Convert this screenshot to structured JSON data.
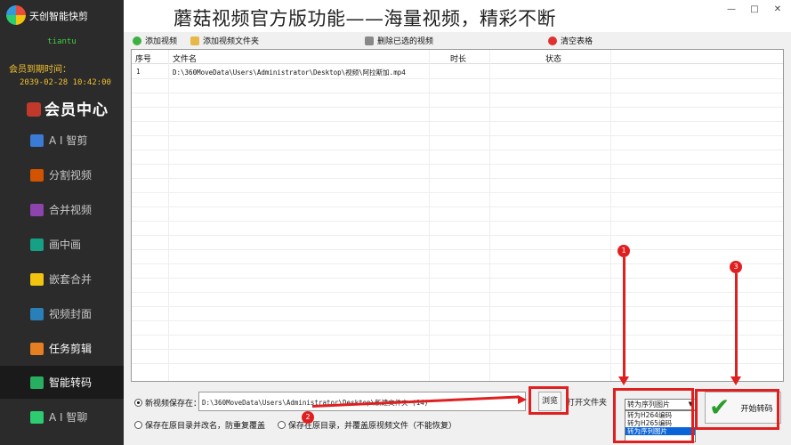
{
  "app": {
    "title": "天创智能快剪",
    "username": "tiantu",
    "expiry_label": "会员到期时间：",
    "expiry_time": "2039-02-28 10:42:00",
    "member_center": "会员中心"
  },
  "sidebar": {
    "items": [
      {
        "label": "A I 智剪",
        "icon": "ai-cut-icon",
        "color": "#3a7bd5"
      },
      {
        "label": "分割视频",
        "icon": "split-video-icon",
        "color": "#d35400"
      },
      {
        "label": "合并视频",
        "icon": "merge-video-icon",
        "color": "#8e44ad"
      },
      {
        "label": "画中画",
        "icon": "picture-in-picture-icon",
        "color": "#16a085"
      },
      {
        "label": "嵌套合并",
        "icon": "nested-merge-icon",
        "color": "#f1c40f"
      },
      {
        "label": "视频封面",
        "icon": "video-cover-icon",
        "color": "#2980b9"
      },
      {
        "label": "任务剪辑",
        "icon": "task-edit-icon",
        "color": "#e67e22"
      },
      {
        "label": "智能转码",
        "icon": "smart-transcode-icon",
        "color": "#27ae60",
        "active": true
      },
      {
        "label": "A I 智聊",
        "icon": "ai-chat-icon",
        "color": "#2ecc71"
      }
    ]
  },
  "banner": {
    "text": "蘑菇视频官方版功能——海量视频，精彩不断"
  },
  "window_controls": [
    "—",
    "□",
    "✕"
  ],
  "toolbar": {
    "add_video": "添加视频",
    "add_folder": "添加视频文件夹",
    "delete_selected": "删除已选的视频",
    "clear_table": "清空表格"
  },
  "table": {
    "columns": [
      "序号",
      "文件名",
      "时长",
      "状态"
    ],
    "rows": [
      {
        "index": "1",
        "filename": "D:\\360MoveData\\Users\\Administrator\\Desktop\\视频\\阿拉斯加.mp4",
        "duration": "",
        "status": ""
      }
    ]
  },
  "output": {
    "save_to_label": "新视频保存在：",
    "save_path": "D:\\360MoveData\\Users\\Administrator\\Desktop\\新建文件夹 (14)",
    "browse": "浏览",
    "open_folder": "打开文件夹",
    "option_rename": "保存在原目录并改名，防重复覆盖",
    "option_overwrite": "保存在原目录，并覆盖原视频文件（不能恢复）"
  },
  "format": {
    "selected": "转为序列图片",
    "options": [
      "转为H264编码",
      "转为H265编码",
      "转为序列图片"
    ]
  },
  "start_button": "开始转码",
  "annotations": {
    "badges": [
      "1",
      "2",
      "3"
    ],
    "color": "#e02020"
  }
}
